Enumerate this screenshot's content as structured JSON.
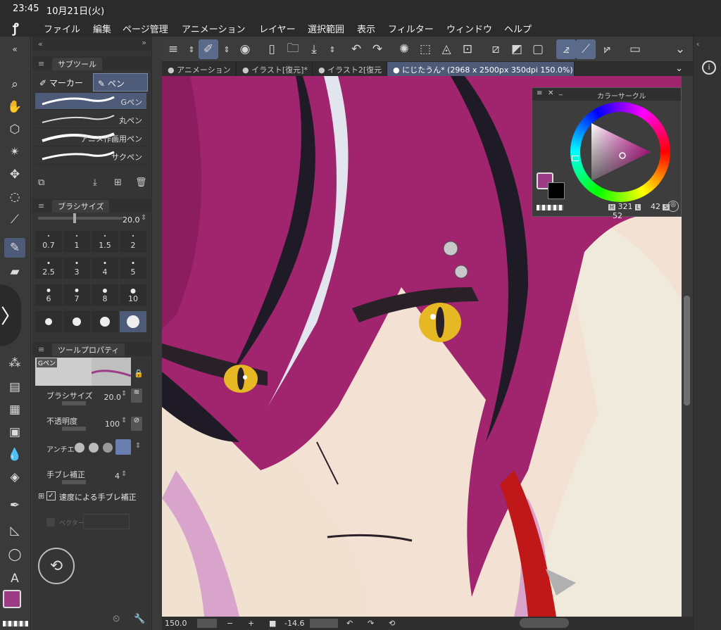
{
  "status": {
    "time": "23:45",
    "date": "10月21日(火)"
  },
  "menu": [
    "ファイル",
    "編集",
    "ページ管理",
    "アニメーション",
    "レイヤー",
    "選択範囲",
    "表示",
    "フィルター",
    "ウィンドウ",
    "ヘルプ"
  ],
  "tabs": [
    {
      "label": "アニメーション",
      "active": false
    },
    {
      "label": "イラスト[復元]*",
      "active": false
    },
    {
      "label": "イラスト2[復元",
      "active": false
    },
    {
      "label": "にじたうん* (2968 x 2500px 350dpi 150.0%)",
      "active": true
    }
  ],
  "subtool": {
    "panel_title": "サブツール",
    "tabs": [
      "マーカー",
      "ペン"
    ],
    "brushes": [
      "Gペン",
      "丸ペン",
      "アニメ作画用ペン",
      "サクペン"
    ]
  },
  "brush_size_panel": {
    "title": "ブラシサイズ",
    "value": "20.0",
    "presets": [
      "0.7",
      "1",
      "1.5",
      "2",
      "2.5",
      "3",
      "4",
      "5",
      "6",
      "7",
      "8",
      "10",
      "",
      "",
      "",
      ""
    ]
  },
  "tool_property": {
    "title": "ツールプロパティ",
    "brush_name": "Gペン",
    "brush_size_label": "ブラシサイズ",
    "brush_size_value": "20.0",
    "opacity_label": "不透明度",
    "opacity_value": "100",
    "antialias_label": "アンチエ",
    "stabilization_label": "手ブレ補正",
    "stabilization_value": "4",
    "speed_stabilization_label": "速度による手ブレ補正",
    "vector_label": "ベクター"
  },
  "color_circle": {
    "title": "カラーサークル",
    "h_label": "H",
    "h_value": "321",
    "l_label": "L",
    "l_value": "42",
    "s_label": "S",
    "s_value": "52",
    "main_color": "#9c3c86",
    "sub_color": "#000000"
  },
  "bottom": {
    "zoom": "150.0",
    "rotation": "-14.6"
  },
  "colors": {
    "accent": "#4d5a78",
    "hair": "#a0246e",
    "skin": "#f3e2d3"
  }
}
